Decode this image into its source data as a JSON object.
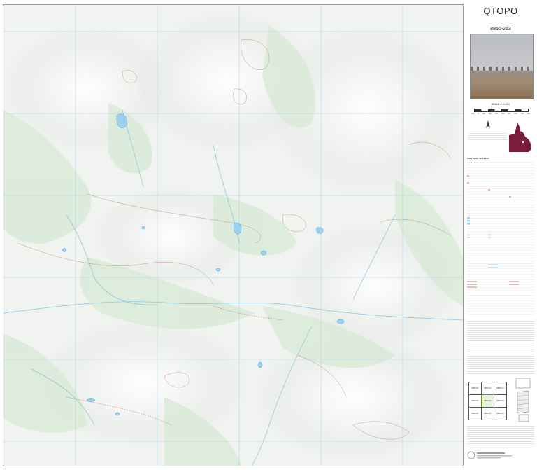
{
  "header": {
    "title": "QTOPO",
    "sheet_number": "8850-213"
  },
  "scale": {
    "label": "SCALE 1:10,000",
    "ticks": [
      "100",
      "0",
      "100",
      "200",
      "300",
      "400",
      "500",
      "600",
      "700",
      "800"
    ]
  },
  "legend": {
    "heading": "POINTS OF INTEREST"
  },
  "grid_index": {
    "cells": [
      [
        "8850-211",
        "8850-212",
        "8850-213"
      ],
      [
        "8850-221",
        "8850-222",
        "8850-223"
      ],
      [
        "8850-231",
        "8850-232",
        "8850-233"
      ]
    ]
  },
  "colors": {
    "water": "#9dd0ee",
    "vegetation": "#d5e8d4",
    "contour": "#b07a5a",
    "grid": "#a8d4e6",
    "queensland": "#7a1c3a",
    "road": "#a33a2a"
  },
  "icons": {
    "north": "north-arrow-icon",
    "queensland_locator": "queensland-locator-icon",
    "folded_map": "folded-map-icon"
  }
}
